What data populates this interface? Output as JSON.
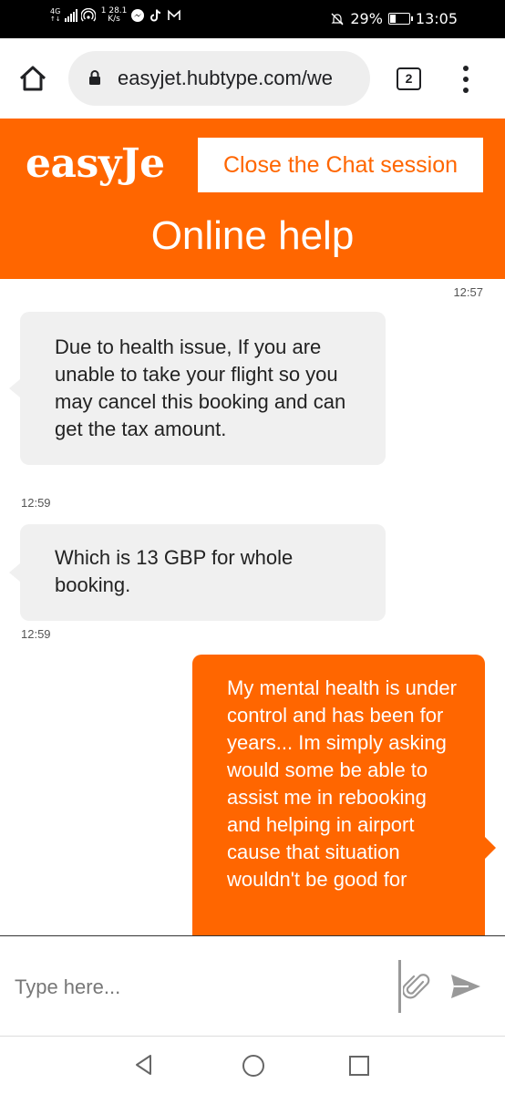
{
  "status_bar": {
    "network": "4G",
    "speed_value": "28.1",
    "speed_unit": "K/s",
    "speed_prefix": "1",
    "battery": "29%",
    "battery_level": 0.29,
    "time": "13:05"
  },
  "browser": {
    "url": "easyjet.hubtype.com/we",
    "tab_count": "2"
  },
  "header": {
    "logo_text": "easyJe",
    "close_button": "Close the Chat session",
    "title": "Online help",
    "colors": {
      "brand": "#ff6600"
    }
  },
  "messages": [
    {
      "direction": "incoming",
      "time": "12:57",
      "text": "Due to health issue, If you are unable to take your flight so you may cancel this booking and can get the tax amount."
    },
    {
      "direction": "incoming",
      "time": "12:59",
      "text": "Which is 13 GBP for whole booking."
    },
    {
      "direction": "outgoing",
      "time": "12:59",
      "text": "My mental health is under control and has been for years... Im simply asking would some be able to assist me in rebooking and helping in airport cause that situation wouldn't be good for"
    }
  ],
  "composer": {
    "placeholder": "Type here..."
  },
  "icons": {
    "status": [
      "signal-icon",
      "hotspot-icon",
      "messenger-icon",
      "tiktok-icon",
      "gmail-icon",
      "mute-icon",
      "battery-icon"
    ],
    "browser": [
      "home-icon",
      "lock-icon",
      "tabs-icon",
      "menu-icon"
    ],
    "composer": [
      "paperclip-icon",
      "send-icon"
    ],
    "nav": [
      "back-icon",
      "home-icon",
      "recent-apps-icon"
    ]
  }
}
